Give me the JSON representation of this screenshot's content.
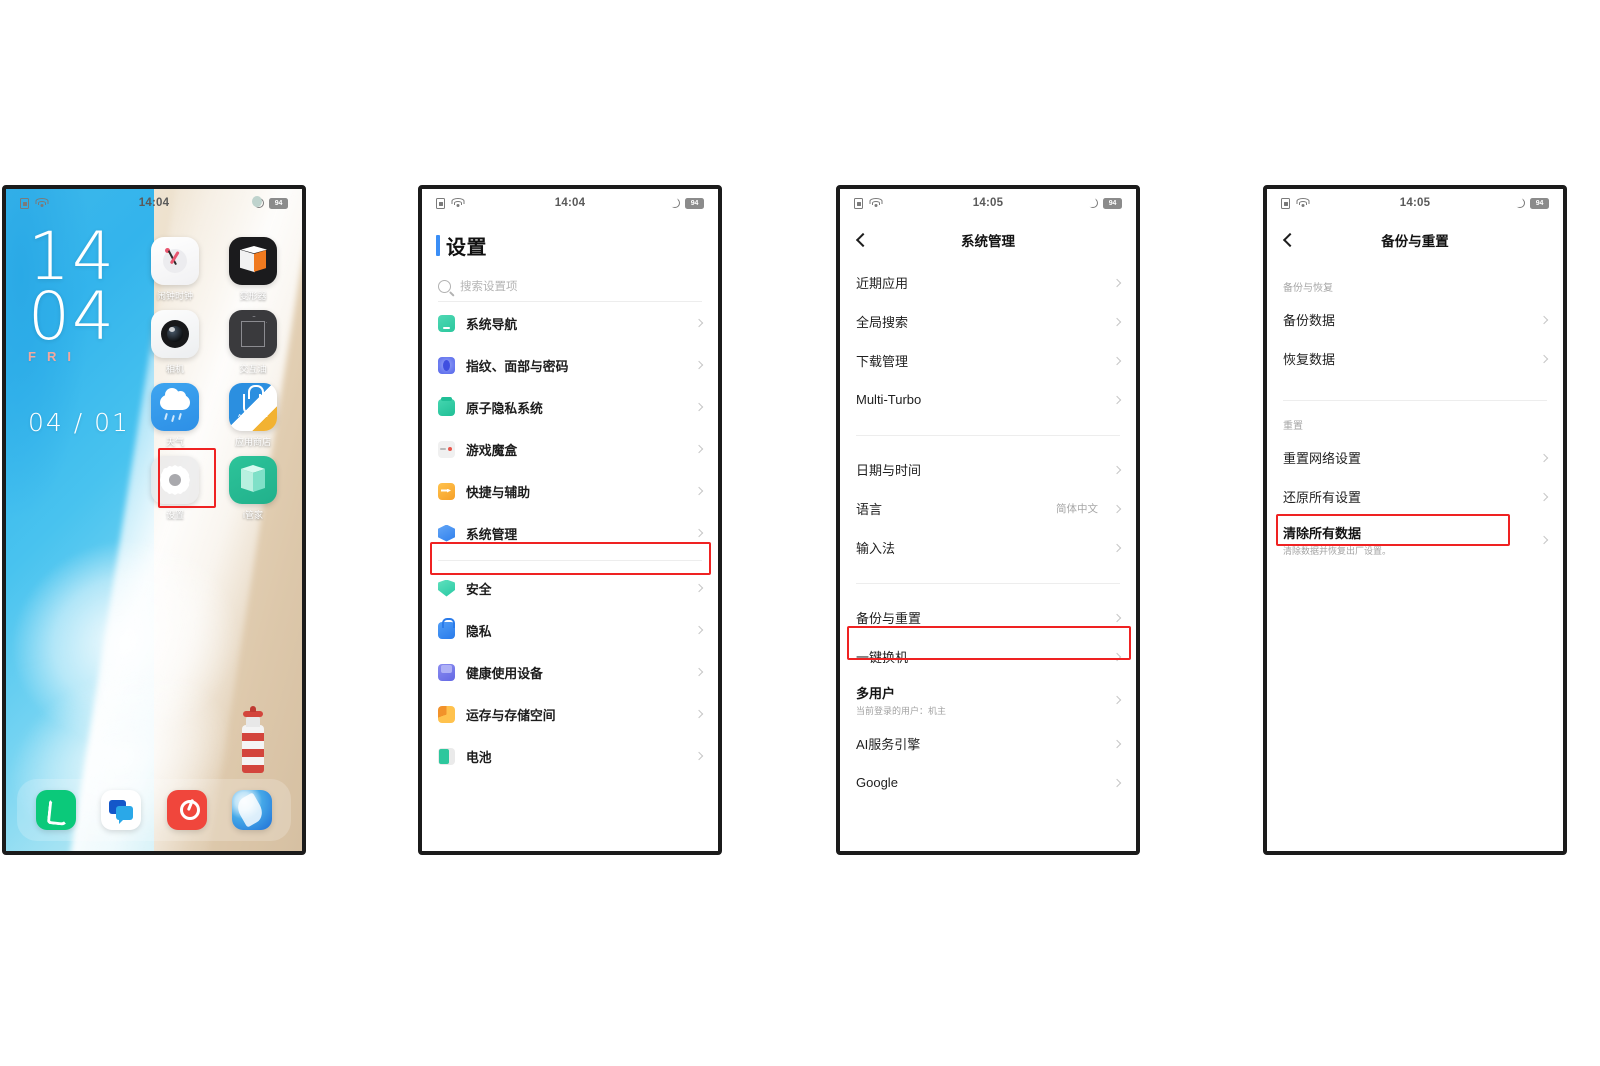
{
  "statusbar": {
    "time_1404": "14:04",
    "time_1405": "14:05",
    "battery": "94",
    "icons": [
      "sim-card-icon",
      "wifi-icon",
      "do-not-disturb-moon-icon",
      "battery-icon"
    ]
  },
  "phone1": {
    "name": "home-screen",
    "clock": {
      "hours": "14",
      "minutes": "04",
      "weekday": "FRI",
      "date": "04 / 01"
    },
    "apps": [
      {
        "label": "闹钟时钟",
        "icon": "alarm-clock-icon"
      },
      {
        "label": "变形器",
        "icon": "transformer-cube-icon"
      },
      {
        "label": "相机",
        "icon": "camera-icon"
      },
      {
        "label": "交互油",
        "icon": "interactive-cube-icon"
      },
      {
        "label": "天气",
        "icon": "weather-icon"
      },
      {
        "label": "应用商店",
        "icon": "app-store-icon"
      },
      {
        "label": "设置",
        "icon": "settings-gear-icon"
      },
      {
        "label": "i管家",
        "icon": "i-manager-icon"
      }
    ],
    "dock": [
      {
        "label": "电话",
        "icon": "phone-icon"
      },
      {
        "label": "信息",
        "icon": "messages-icon"
      },
      {
        "label": "音乐",
        "icon": "music-icon"
      },
      {
        "label": "浏览器",
        "icon": "browser-icon"
      }
    ],
    "highlight": "设置"
  },
  "phone2": {
    "name": "settings-main",
    "title": "设置",
    "search_placeholder": "搜索设置项",
    "group1": [
      {
        "label": "系统导航",
        "icon": "system-navigation-icon"
      },
      {
        "label": "指纹、面部与密码",
        "icon": "fingerprint-face-password-icon"
      },
      {
        "label": "原子隐私系统",
        "icon": "atomic-privacy-icon"
      },
      {
        "label": "游戏魔盒",
        "icon": "game-box-icon"
      },
      {
        "label": "快捷与辅助",
        "icon": "shortcuts-accessibility-icon"
      },
      {
        "label": "系统管理",
        "icon": "system-management-icon"
      }
    ],
    "group2": [
      {
        "label": "安全",
        "icon": "security-shield-icon"
      },
      {
        "label": "隐私",
        "icon": "privacy-lock-icon"
      },
      {
        "label": "健康使用设备",
        "icon": "digital-wellbeing-icon"
      },
      {
        "label": "运存与存储空间",
        "icon": "storage-icon"
      },
      {
        "label": "电池",
        "icon": "battery-icon"
      }
    ],
    "highlight": "系统管理"
  },
  "phone3": {
    "name": "system-management",
    "nav_title": "系统管理",
    "back_icon": "back-chevron-icon",
    "group1": [
      {
        "label": "近期应用"
      },
      {
        "label": "全局搜索"
      },
      {
        "label": "下载管理"
      },
      {
        "label": "Multi-Turbo"
      }
    ],
    "group2": [
      {
        "label": "日期与时间"
      },
      {
        "label": "语言",
        "value": "简体中文"
      },
      {
        "label": "输入法"
      }
    ],
    "group3": [
      {
        "label": "备份与重置"
      },
      {
        "label": "一键换机"
      },
      {
        "label": "多用户",
        "sub": "当前登录的用户：机主"
      },
      {
        "label": "AI服务引擎"
      },
      {
        "label": "Google"
      }
    ],
    "highlight": "备份与重置"
  },
  "phone4": {
    "name": "backup-and-reset",
    "nav_title": "备份与重置",
    "back_icon": "back-chevron-icon",
    "section1_label": "备份与恢复",
    "section1": [
      {
        "label": "备份数据"
      },
      {
        "label": "恢复数据"
      }
    ],
    "section2_label": "重置",
    "section2": [
      {
        "label": "重置网络设置"
      },
      {
        "label": "还原所有设置"
      },
      {
        "label": "清除所有数据",
        "sub": "清除数据并恢复出厂设置。"
      }
    ],
    "highlight": "还原所有设置"
  },
  "colors": {
    "highlight_red": "#ef2222",
    "title_accent_blue": "#3a8ef6",
    "chevron_gray": "#c6c6c6"
  }
}
